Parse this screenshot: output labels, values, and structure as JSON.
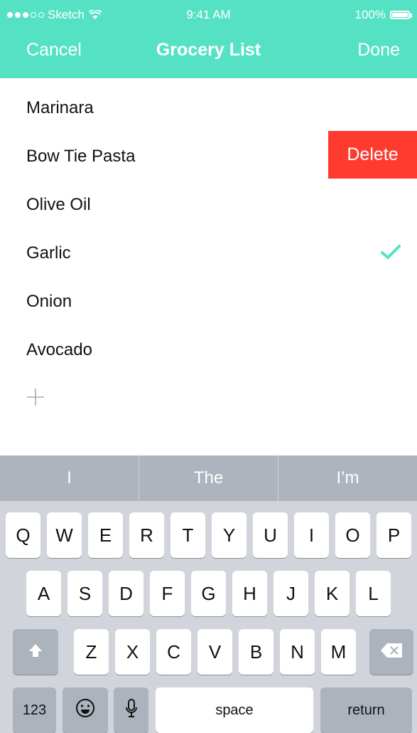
{
  "status_bar": {
    "carrier": "Sketch",
    "time": "9:41 AM",
    "battery": "100%"
  },
  "nav": {
    "cancel": "Cancel",
    "title": "Grocery List",
    "done": "Done"
  },
  "list": {
    "items": [
      {
        "label": "Marinara"
      },
      {
        "label": "Bow Tie Pasta"
      },
      {
        "label": "Olive Oil"
      },
      {
        "label": "Garlic"
      },
      {
        "label": "Onion"
      },
      {
        "label": "Avocado"
      }
    ],
    "delete_label": "Delete",
    "checked_item": "Garlic"
  },
  "keyboard": {
    "suggestions": [
      "I",
      "The",
      "I’m"
    ],
    "row1": [
      "Q",
      "W",
      "E",
      "R",
      "T",
      "Y",
      "U",
      "I",
      "O",
      "P"
    ],
    "row2": [
      "A",
      "S",
      "D",
      "F",
      "G",
      "H",
      "J",
      "K",
      "L"
    ],
    "row3": [
      "Z",
      "X",
      "C",
      "V",
      "B",
      "N",
      "M"
    ],
    "numbers_label": "123",
    "space_label": "space",
    "return_label": "return"
  },
  "colors": {
    "accent": "#55e2c4",
    "delete": "#ff3b30",
    "keyboard_bg": "#d1d5db",
    "suggest_bg": "#aeb4bd"
  },
  "icons": {
    "signal": "signal-dots-icon",
    "wifi": "wifi-icon",
    "battery": "battery-icon",
    "check": "checkmark-icon",
    "add": "plus-icon",
    "shift": "shift-arrow-icon",
    "delete": "backspace-icon",
    "emoji": "emoji-face-icon",
    "mic": "microphone-icon"
  }
}
